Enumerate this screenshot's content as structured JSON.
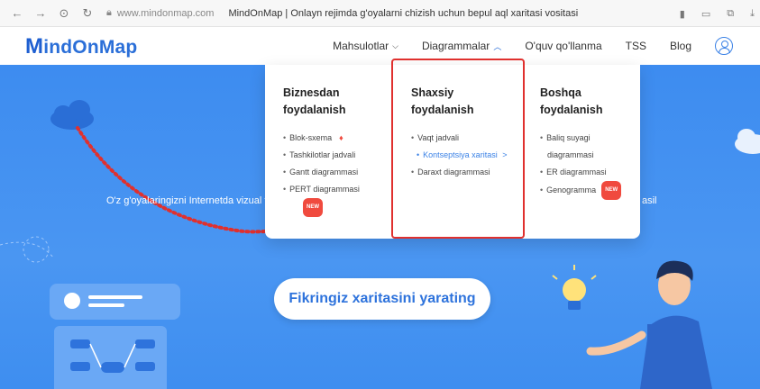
{
  "browser": {
    "url": "www.mindonmap.com",
    "title": "MindOnMap | Onlayn rejimda g'oyalarni chizish uchun bepul aql xaritasi vositasi",
    "back_icon": "arrow-left-icon",
    "forward_icon": "arrow-right-icon",
    "reload_icon": "reload-icon"
  },
  "header": {
    "logo_first": "M",
    "logo_rest": "indOnMap",
    "nav": {
      "products": "Mahsulotlar",
      "diagrams": "Diagrammalar",
      "tutorial": "O'quv qo'llanma",
      "faq": "TSS",
      "blog": "Blog"
    }
  },
  "dropdown": {
    "business": {
      "title_line1": "Biznesdan",
      "title_line2": "foydalanish",
      "items": [
        "Blok-sxema",
        "Tashkilotlar jadvali",
        "Gantt diagrammasi",
        "PERT diagrammasi"
      ],
      "new_badge": "NEW"
    },
    "personal": {
      "title_line1": "Shaxsiy",
      "title_line2": "foydalanish",
      "items": [
        "Vaqt jadvali",
        "Kontseptsiya xaritasi",
        "Daraxt diagrammasi"
      ],
      "chevron": ">"
    },
    "other": {
      "title_line1": "Boshqa",
      "title_line2": "foydalanish",
      "items": [
        "Baliq suyagi",
        "diagrammasi",
        "ER diagrammasi",
        "Genogramma"
      ],
      "new_badge": "NEW"
    }
  },
  "hero": {
    "text_left": "O'z g'oyalaringizni Internetda vizual ta",
    "text_right": "asil",
    "cta": "Fikringiz xaritasini yarating"
  },
  "colors": {
    "accent": "#2b6fd8",
    "hero_blue": "#4a96f2",
    "highlight_red": "#e0302e",
    "badge_red": "#f04a3e"
  }
}
